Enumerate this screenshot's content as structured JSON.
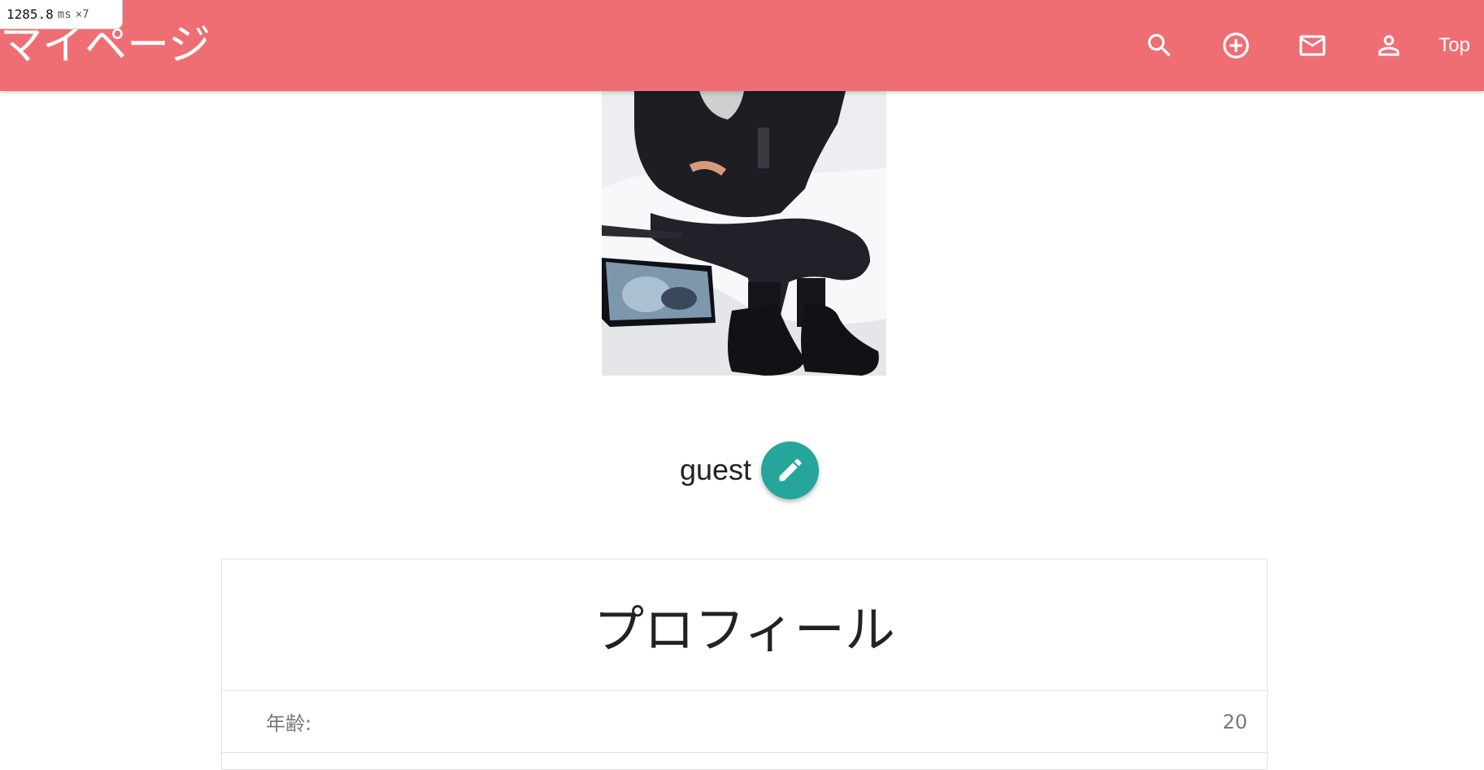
{
  "perf_badge": {
    "value": "1285.8",
    "unit": "ms",
    "multiplier": "×7"
  },
  "header": {
    "title": "マイページ",
    "nav_icons": [
      "search-icon",
      "add-circle-icon",
      "mail-icon",
      "person-icon"
    ],
    "top_link": "Top",
    "background_color": "#ef6e74"
  },
  "profile_image": {
    "alt": "profile photo"
  },
  "user": {
    "name": "guest",
    "edit_icon": "pencil-icon",
    "edit_button_color": "#26a69a"
  },
  "profile": {
    "title": "プロフィール",
    "rows": [
      {
        "label": "年齢:",
        "value": "20"
      }
    ]
  }
}
